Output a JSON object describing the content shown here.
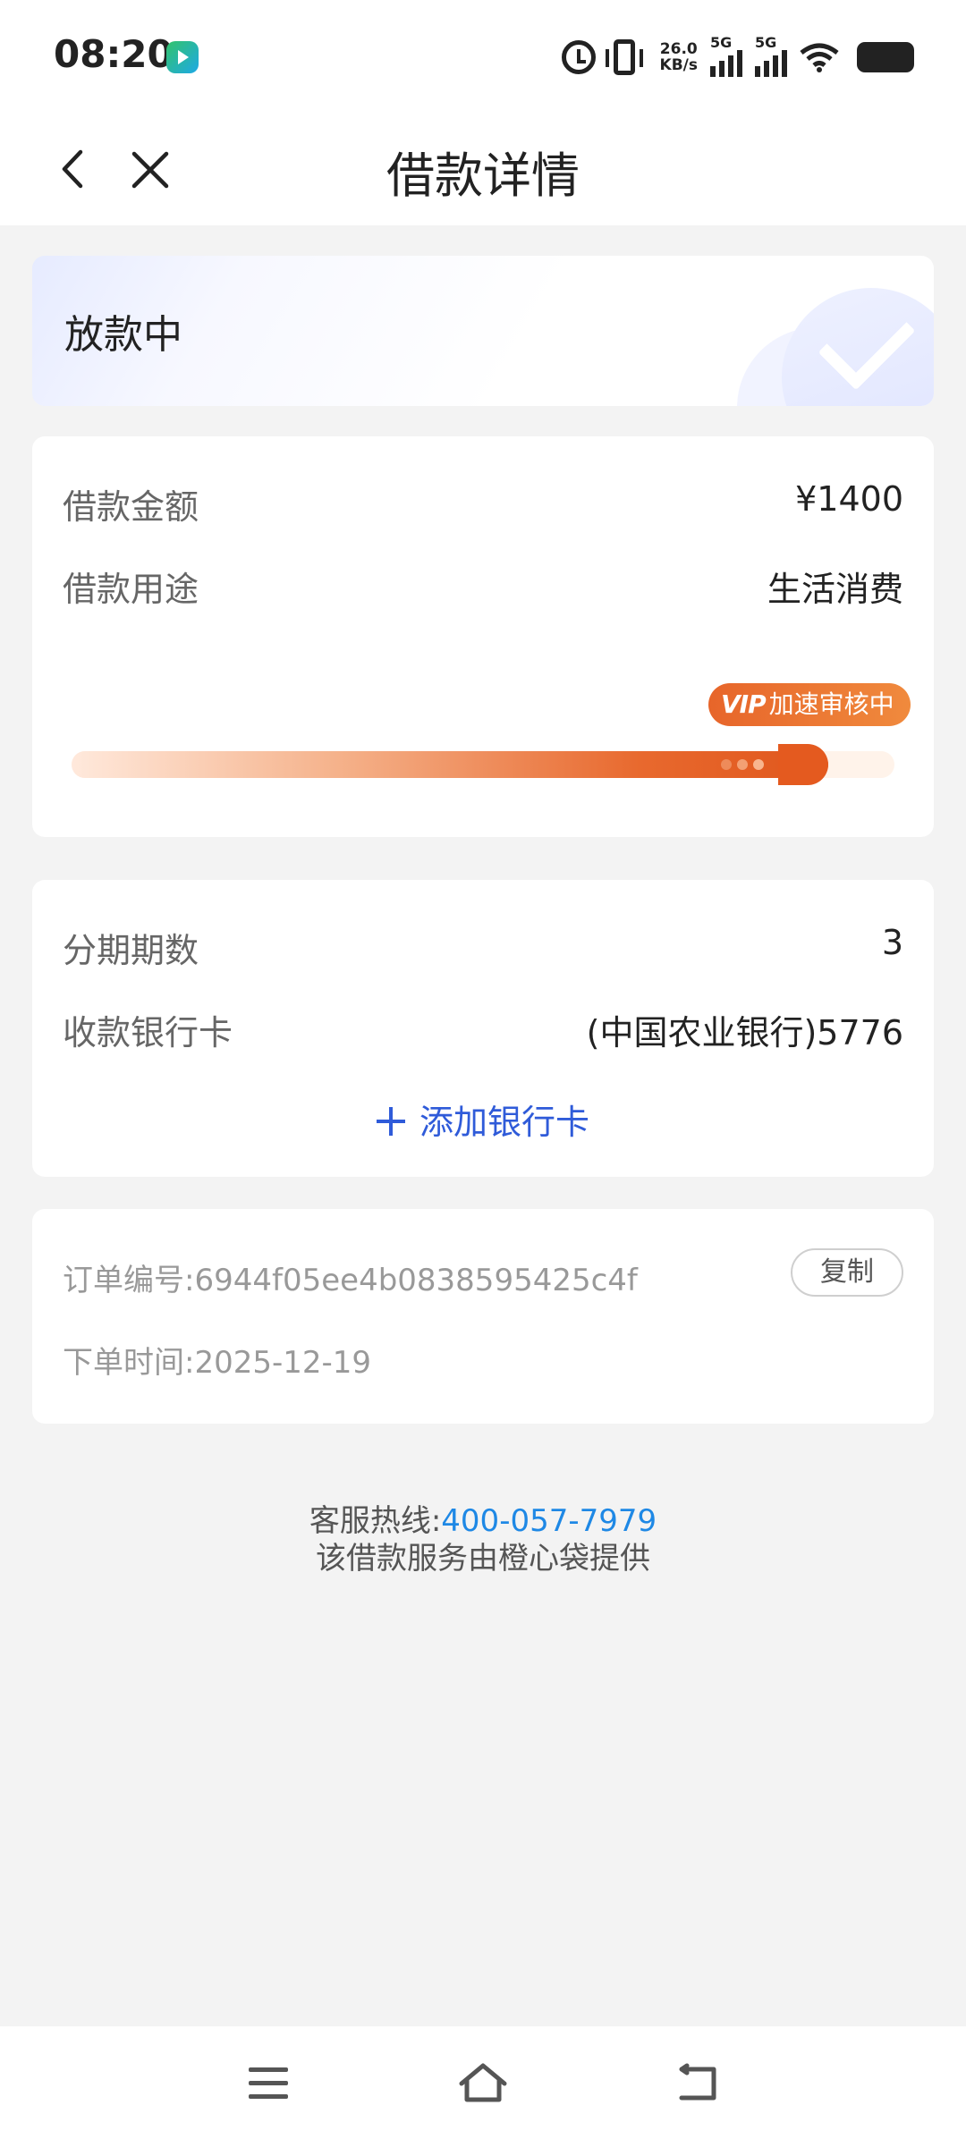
{
  "status_bar": {
    "time": "08:20",
    "net_speed_value": "26.0",
    "net_speed_unit": "KB/s",
    "signal1_label": "5G",
    "signal2_label": "5G",
    "icons": [
      "app-icon",
      "alarm-icon",
      "vibrate-icon",
      "signal-icon",
      "wifi-icon",
      "battery-icon"
    ]
  },
  "header": {
    "title": "借款详情",
    "back_icon": "back-icon",
    "close_icon": "close-icon"
  },
  "status_card": {
    "status": "放款中",
    "icon": "check-icon"
  },
  "loan": {
    "amount_label": "借款金额",
    "amount_value": "¥1400",
    "purpose_label": "借款用途",
    "purpose_value": "生活消费",
    "badge_vip": "VIP",
    "badge_text": "加速审核中",
    "progress": 0.92
  },
  "bank": {
    "installments_label": "分期期数",
    "installments_value": "3",
    "card_label": "收款银行卡",
    "card_value": "(中国农业银行)5776",
    "add_card_label": "添加银行卡"
  },
  "order": {
    "number_label": "订单编号:",
    "number_value": "6944f05ee4b0838595425c4f",
    "copy_label": "复制",
    "time_label": "下单时间:",
    "time_value": "2025-12-19"
  },
  "footer": {
    "hotline_label": "客服热线:",
    "hotline_number": "400-057-7979",
    "provider_text": "该借款服务由橙心袋提供"
  },
  "colors": {
    "accent_blue": "#2f5bd9",
    "hotline_blue": "#1e88e5",
    "progress_orange": "#e45a1f",
    "background": "#f3f3f3"
  }
}
